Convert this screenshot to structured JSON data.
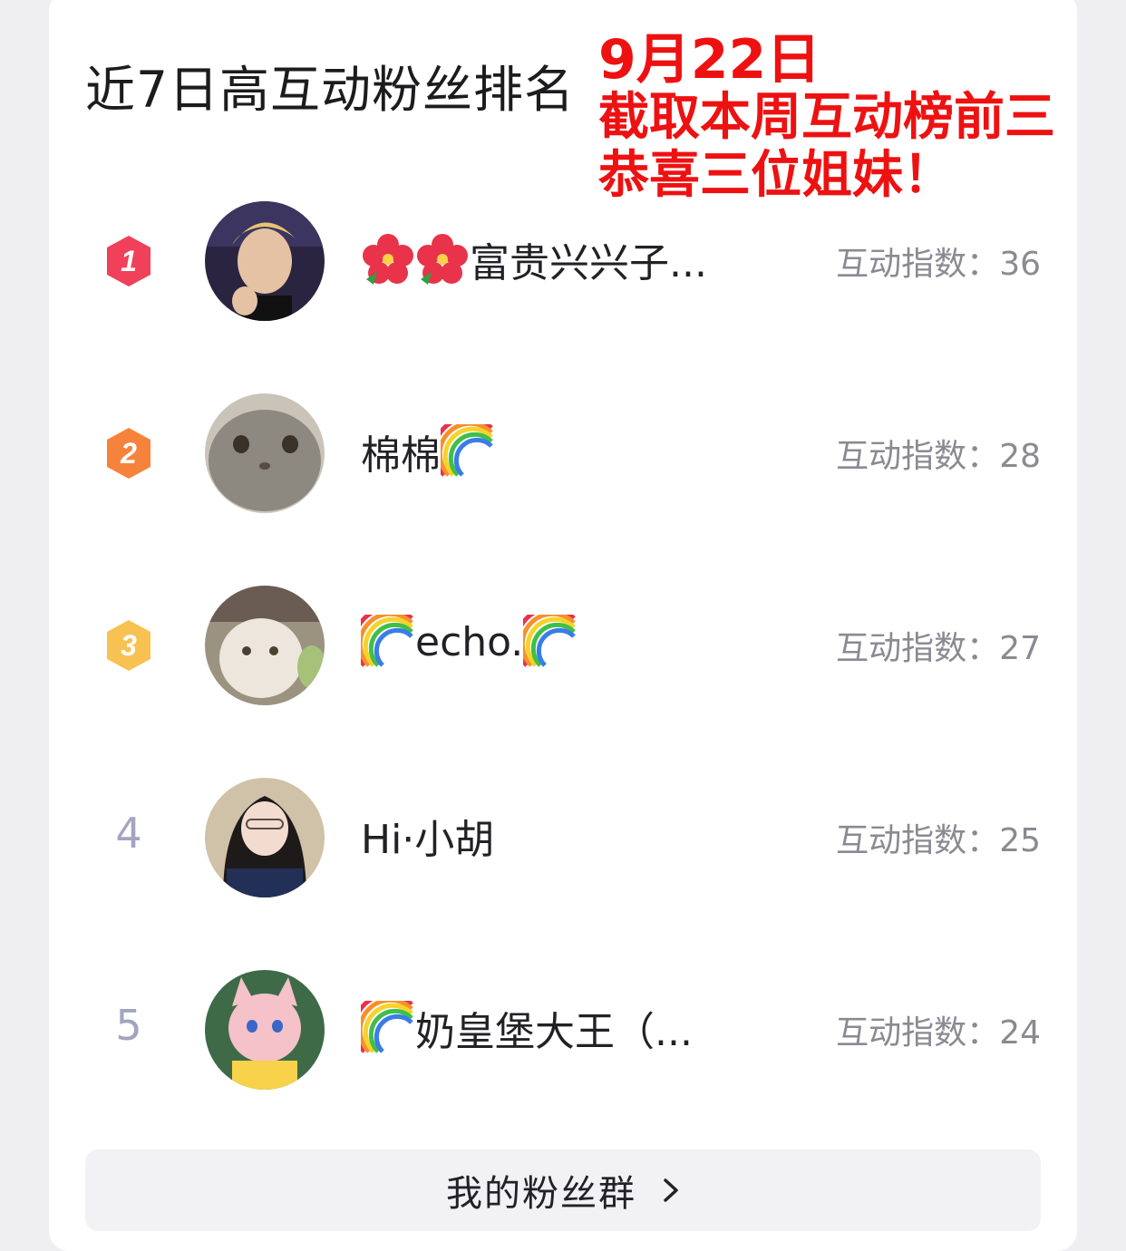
{
  "title": "近7日高互动粉丝排名",
  "annotation": {
    "line1": "9月22日",
    "line2": "截取本周互动榜前三",
    "line3": "恭喜三位姐妹！"
  },
  "score_label": "互动指数：",
  "fans": [
    {
      "rank": "1",
      "name": "富贵兴兴子...",
      "score": "36",
      "badge_color": "#f0405a",
      "prefix_icons": [
        "hibiscus-icon",
        "hibiscus-icon"
      ],
      "suffix_icons": []
    },
    {
      "rank": "2",
      "name": "棉棉",
      "score": "28",
      "badge_color": "#f5833c",
      "prefix_icons": [],
      "suffix_icons": [
        "rainbow-icon"
      ]
    },
    {
      "rank": "3",
      "name": "echo.",
      "score": "27",
      "badge_color": "#f7c251",
      "prefix_icons": [
        "rainbow-icon"
      ],
      "suffix_icons": [
        "rainbow-icon"
      ]
    },
    {
      "rank": "4",
      "name": "Hi·小胡",
      "score": "25",
      "badge_color": "",
      "prefix_icons": [],
      "suffix_icons": []
    },
    {
      "rank": "5",
      "name": "奶皇堡大王（...",
      "score": "24",
      "badge_color": "",
      "prefix_icons": [
        "rainbow-icon"
      ],
      "suffix_icons": []
    }
  ],
  "footer": {
    "label": "我的粉丝群",
    "icon": "chevron-right-icon"
  }
}
